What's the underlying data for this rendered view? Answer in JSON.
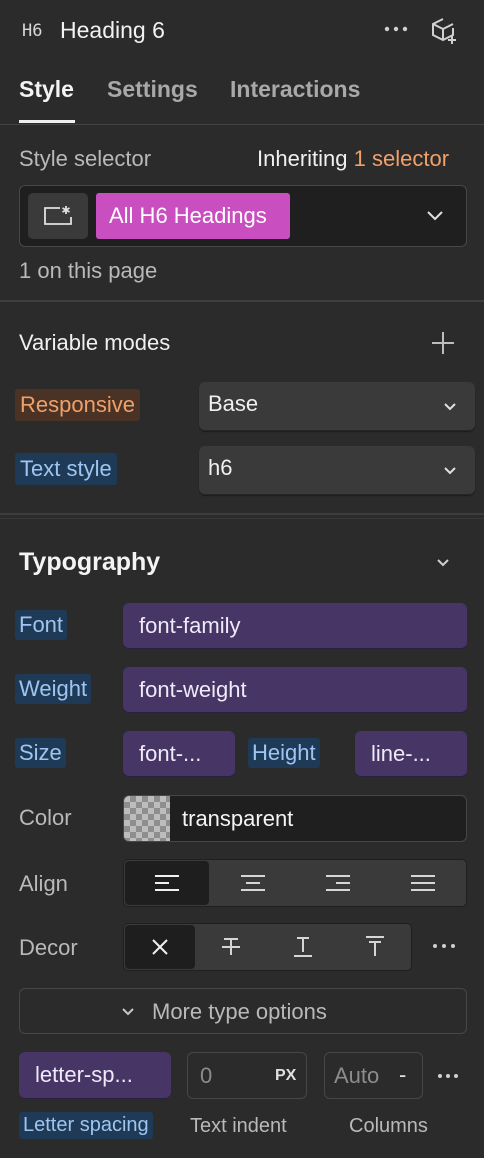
{
  "header": {
    "element_tag": "H6",
    "element_name": "Heading 6"
  },
  "tabs": [
    {
      "label": "Style",
      "active": true
    },
    {
      "label": "Settings",
      "active": false
    },
    {
      "label": "Interactions",
      "active": false
    }
  ],
  "style_selector": {
    "label": "Style selector",
    "inheriting_prefix": "Inheriting",
    "inheriting_link": "1 selector",
    "selector_name": "All H6 Headings",
    "on_page": "1 on this page"
  },
  "variable_modes": {
    "title": "Variable modes",
    "rows": [
      {
        "label": "Responsive",
        "value": "Base"
      },
      {
        "label": "Text style",
        "value": "h6"
      }
    ]
  },
  "typography": {
    "title": "Typography",
    "font_label": "Font",
    "font_value": "font-family",
    "weight_label": "Weight",
    "weight_value": "font-weight",
    "size_label": "Size",
    "size_value": "font-...",
    "height_label": "Height",
    "height_value": "line-...",
    "color_label": "Color",
    "color_value": "transparent",
    "align_label": "Align",
    "decor_label": "Decor",
    "more_options": "More type options",
    "letter_spacing_value": "letter-sp...",
    "text_indent_value": "0",
    "text_indent_unit": "PX",
    "columns_value": "Auto",
    "columns_stepper": "-",
    "letter_spacing_label": "Letter spacing",
    "text_indent_label": "Text indent",
    "columns_label": "Columns"
  },
  "colors": {
    "accent_orange": "#f0a06a",
    "selector_pink": "#c94fc0",
    "variable_purple": "#463565",
    "variable_blue": "#1f3a56"
  }
}
